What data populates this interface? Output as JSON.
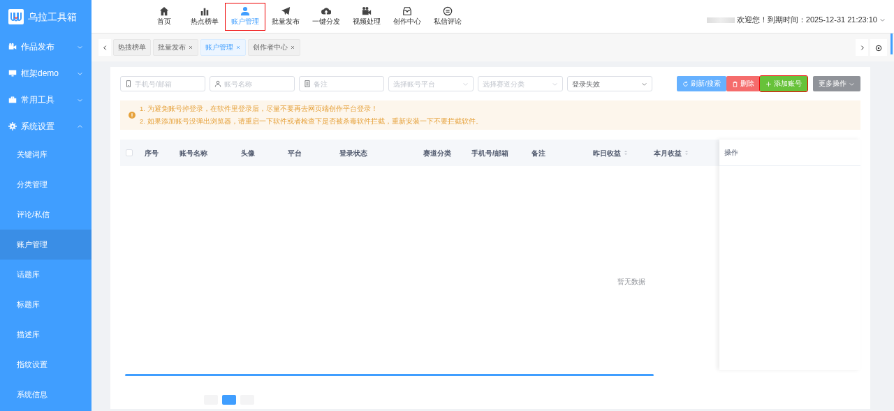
{
  "app": {
    "name": "乌拉工具箱"
  },
  "top_nav": [
    {
      "label": "首页",
      "selected": false,
      "highlighted": false
    },
    {
      "label": "热点榜单",
      "selected": false,
      "highlighted": false
    },
    {
      "label": "账户管理",
      "selected": true,
      "highlighted": true
    },
    {
      "label": "批量发布",
      "selected": false,
      "highlighted": false
    },
    {
      "label": "一键分发",
      "selected": false,
      "highlighted": false
    },
    {
      "label": "视频处理",
      "selected": false,
      "highlighted": false
    },
    {
      "label": "创作中心",
      "selected": false,
      "highlighted": false
    },
    {
      "label": "私信评论",
      "selected": false,
      "highlighted": false
    }
  ],
  "user_info": {
    "text": "欢迎您！到期时间：2025-12-31 21:23:10"
  },
  "sidebar": {
    "items": [
      {
        "label": "作品发布",
        "expanded": false
      },
      {
        "label": "框架demo",
        "expanded": false
      },
      {
        "label": "常用工具",
        "expanded": false
      },
      {
        "label": "系统设置",
        "expanded": true,
        "children": [
          {
            "label": "关键词库",
            "selected": false
          },
          {
            "label": "分类管理",
            "selected": false
          },
          {
            "label": "评论/私信",
            "selected": false
          },
          {
            "label": "账户管理",
            "selected": true
          },
          {
            "label": "话题库",
            "selected": false
          },
          {
            "label": "标题库",
            "selected": false
          },
          {
            "label": "描述库",
            "selected": false
          },
          {
            "label": "指纹设置",
            "selected": false
          },
          {
            "label": "系统信息",
            "selected": false
          }
        ]
      }
    ]
  },
  "tabs": [
    {
      "label": "热搜榜单",
      "closable": false,
      "selected": false
    },
    {
      "label": "批量发布",
      "closable": true,
      "selected": false
    },
    {
      "label": "账户管理",
      "closable": true,
      "selected": true
    },
    {
      "label": "创作者中心",
      "closable": true,
      "selected": false
    }
  ],
  "filters": [
    {
      "kind": "input",
      "placeholder": "手机号/邮箱"
    },
    {
      "kind": "input",
      "placeholder": "账号名称"
    },
    {
      "kind": "input",
      "placeholder": "备注"
    },
    {
      "kind": "select",
      "placeholder": "选择账号平台"
    },
    {
      "kind": "select",
      "placeholder": "选择赛道分类"
    },
    {
      "kind": "select",
      "value": "登录失效"
    }
  ],
  "actions": [
    {
      "label": "刷新/搜索",
      "kind": "refresh",
      "highlighted": false
    },
    {
      "label": "删除",
      "kind": "delete",
      "highlighted": false
    },
    {
      "label": "添加账号",
      "kind": "add",
      "highlighted": true
    },
    {
      "label": "更多操作",
      "kind": "more",
      "highlighted": false
    }
  ],
  "notice": {
    "lines": [
      "1. 为避免账号掉登录，在软件里登录后，尽量不要再去网页端创作平台登录！",
      "2. 如果添加账号没弹出浏览器，请重启一下软件或者检查下是否被杀毒软件拦截，重新安装一下不要拦截软件。"
    ]
  },
  "table": {
    "columns": [
      {
        "label": "序号",
        "sortable": false
      },
      {
        "label": "账号名称",
        "sortable": false
      },
      {
        "label": "头像",
        "sortable": false
      },
      {
        "label": "平台",
        "sortable": false
      },
      {
        "label": "登录状态",
        "sortable": false
      },
      {
        "label": "赛道分类",
        "sortable": false
      },
      {
        "label": "手机号/邮箱",
        "sortable": false
      },
      {
        "label": "备注",
        "sortable": false
      },
      {
        "label": "昨日收益",
        "sortable": true
      },
      {
        "label": "本月收益",
        "sortable": true
      }
    ],
    "select_all": {
      "checked": false
    },
    "fixed_column": "操作",
    "empty_text": "暂无数据"
  },
  "pager": [
    {
      "selected": false
    },
    {
      "selected": true
    },
    {
      "selected": false
    }
  ]
}
